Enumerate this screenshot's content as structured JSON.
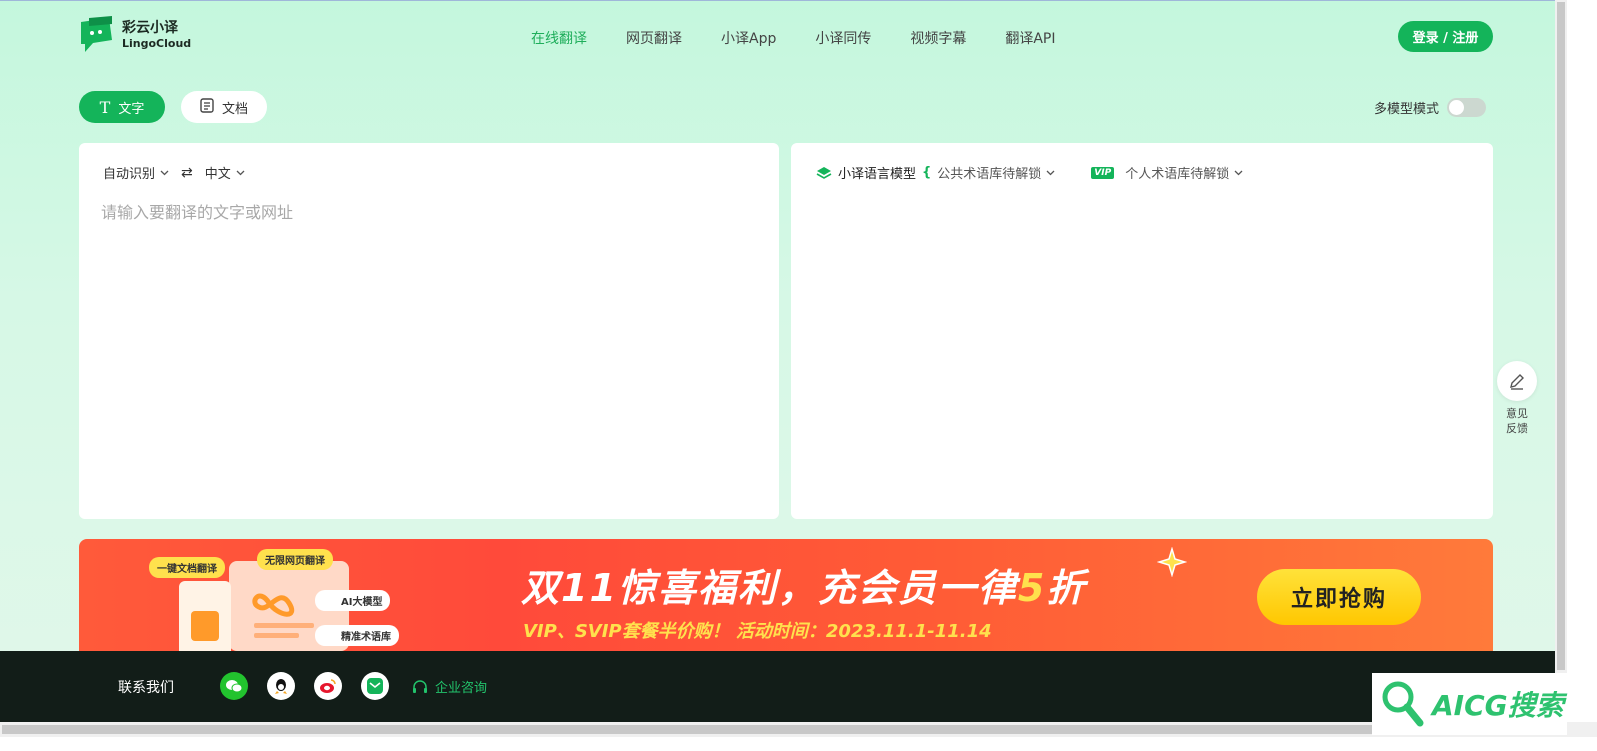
{
  "brand": {
    "name_cn": "彩云小译",
    "name_en": "LingoCloud"
  },
  "nav": [
    {
      "label": "在线翻译",
      "active": true
    },
    {
      "label": "网页翻译",
      "active": false
    },
    {
      "label": "小译App",
      "active": false
    },
    {
      "label": "小译同传",
      "active": false
    },
    {
      "label": "视频字幕",
      "active": false
    },
    {
      "label": "翻译API",
      "active": false
    }
  ],
  "login_label": "登录 / 注册",
  "modes": {
    "text_label": "文字",
    "doc_label": "文档",
    "active": "text"
  },
  "multi_model": {
    "label": "多模型模式",
    "enabled": false
  },
  "source": {
    "lang": "自动识别",
    "target": "中文",
    "placeholder": "请输入要翻译的文字或网址",
    "value": ""
  },
  "result": {
    "model_label": "小译语言模型",
    "public_term": "公共术语库待解锁",
    "vip_badge": "VIP",
    "personal_term": "个人术语库待解锁"
  },
  "feedback": {
    "line1": "意见",
    "line2": "反馈"
  },
  "banner": {
    "title_pre": "双11惊喜福利，充会员一律",
    "title_hl": "5",
    "title_post": "折",
    "subtitle": "VIP、SVIP套餐半价购！ 活动时间：2023.11.1-11.14",
    "button": "立即抢购",
    "pill_doc": "一键文档翻译",
    "pill_web": "无限网页翻译",
    "pill_ai": "AI大模型",
    "pill_term": "精准术语库"
  },
  "footer": {
    "contact_label": "联系我们",
    "consult_label": "企业咨询"
  },
  "watermark": "AICG搜索",
  "colors": {
    "accent": "#14b45a",
    "banner_bg": "#ff5a3a",
    "footer_bg": "#121d18",
    "highlight": "#ffe14d"
  }
}
